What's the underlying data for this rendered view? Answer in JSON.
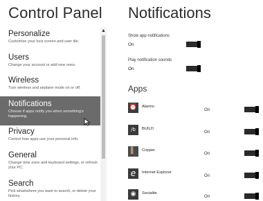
{
  "left_pane": {
    "title": "Control Panel",
    "categories": [
      {
        "title": "Personalize",
        "description": "Customize your lock screen and user tile.",
        "selected": false
      },
      {
        "title": "Users",
        "description": "Change your account or add new ones.",
        "selected": false
      },
      {
        "title": "Wireless",
        "description": "Turn wireless and airplane mode on or off.",
        "selected": false
      },
      {
        "title": "Notifications",
        "description": "Choose if apps notify you when something's happening.",
        "selected": true
      },
      {
        "title": "Privacy",
        "description": "Control how apps use your personal info.",
        "selected": false
      },
      {
        "title": "General",
        "description": "Change time zone and keyboard settings, or refresh your PC.",
        "selected": false
      },
      {
        "title": "Search",
        "description": "Pick what/where you want to search, or delete your history.",
        "selected": false
      }
    ]
  },
  "main": {
    "title": "Notifications",
    "settings": [
      {
        "label": "Show app notifications",
        "value": "On"
      },
      {
        "label": "Play notification sounds",
        "value": "On"
      }
    ],
    "apps_heading": "Apps",
    "apps": [
      {
        "name": "Alarms",
        "state": "On",
        "icon": "alarm-clock-icon",
        "glyph": "⏰"
      },
      {
        "name": "BUILD",
        "state": "On",
        "icon": "build-logo-icon",
        "glyph": "/b"
      },
      {
        "name": "Copper",
        "state": "On",
        "icon": "copper-game-icon",
        "glyph": "▌"
      },
      {
        "name": "Internet Explorer",
        "state": "On",
        "icon": "internet-explorer-icon",
        "glyph": "e"
      },
      {
        "name": "Socialite",
        "state": "On",
        "icon": "socialite-icon",
        "glyph": "◉"
      }
    ]
  },
  "colors": {
    "selected_background": "#6b6b6b",
    "toggle_fill": "#2a2a2a",
    "app_tile": "#3b3b3b"
  }
}
